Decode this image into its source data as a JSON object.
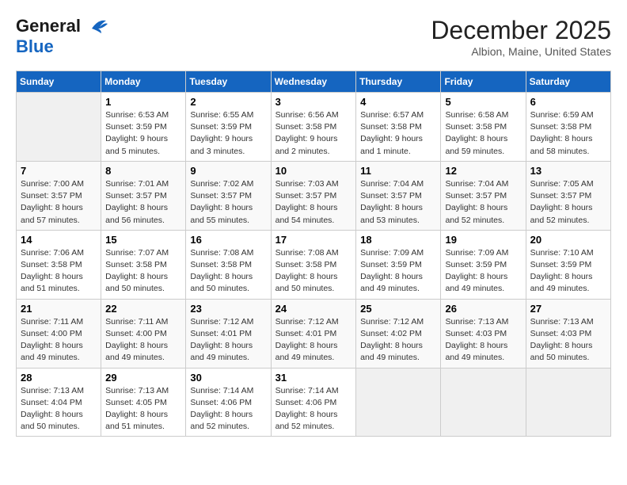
{
  "logo": {
    "general": "General",
    "blue": "Blue"
  },
  "title": "December 2025",
  "location": "Albion, Maine, United States",
  "days_of_week": [
    "Sunday",
    "Monday",
    "Tuesday",
    "Wednesday",
    "Thursday",
    "Friday",
    "Saturday"
  ],
  "weeks": [
    [
      {
        "day": "",
        "empty": true
      },
      {
        "day": "1",
        "sunrise": "Sunrise: 6:53 AM",
        "sunset": "Sunset: 3:59 PM",
        "daylight": "Daylight: 9 hours and 5 minutes."
      },
      {
        "day": "2",
        "sunrise": "Sunrise: 6:55 AM",
        "sunset": "Sunset: 3:59 PM",
        "daylight": "Daylight: 9 hours and 3 minutes."
      },
      {
        "day": "3",
        "sunrise": "Sunrise: 6:56 AM",
        "sunset": "Sunset: 3:58 PM",
        "daylight": "Daylight: 9 hours and 2 minutes."
      },
      {
        "day": "4",
        "sunrise": "Sunrise: 6:57 AM",
        "sunset": "Sunset: 3:58 PM",
        "daylight": "Daylight: 9 hours and 1 minute."
      },
      {
        "day": "5",
        "sunrise": "Sunrise: 6:58 AM",
        "sunset": "Sunset: 3:58 PM",
        "daylight": "Daylight: 8 hours and 59 minutes."
      },
      {
        "day": "6",
        "sunrise": "Sunrise: 6:59 AM",
        "sunset": "Sunset: 3:58 PM",
        "daylight": "Daylight: 8 hours and 58 minutes."
      }
    ],
    [
      {
        "day": "7",
        "sunrise": "Sunrise: 7:00 AM",
        "sunset": "Sunset: 3:57 PM",
        "daylight": "Daylight: 8 hours and 57 minutes."
      },
      {
        "day": "8",
        "sunrise": "Sunrise: 7:01 AM",
        "sunset": "Sunset: 3:57 PM",
        "daylight": "Daylight: 8 hours and 56 minutes."
      },
      {
        "day": "9",
        "sunrise": "Sunrise: 7:02 AM",
        "sunset": "Sunset: 3:57 PM",
        "daylight": "Daylight: 8 hours and 55 minutes."
      },
      {
        "day": "10",
        "sunrise": "Sunrise: 7:03 AM",
        "sunset": "Sunset: 3:57 PM",
        "daylight": "Daylight: 8 hours and 54 minutes."
      },
      {
        "day": "11",
        "sunrise": "Sunrise: 7:04 AM",
        "sunset": "Sunset: 3:57 PM",
        "daylight": "Daylight: 8 hours and 53 minutes."
      },
      {
        "day": "12",
        "sunrise": "Sunrise: 7:04 AM",
        "sunset": "Sunset: 3:57 PM",
        "daylight": "Daylight: 8 hours and 52 minutes."
      },
      {
        "day": "13",
        "sunrise": "Sunrise: 7:05 AM",
        "sunset": "Sunset: 3:57 PM",
        "daylight": "Daylight: 8 hours and 52 minutes."
      }
    ],
    [
      {
        "day": "14",
        "sunrise": "Sunrise: 7:06 AM",
        "sunset": "Sunset: 3:58 PM",
        "daylight": "Daylight: 8 hours and 51 minutes."
      },
      {
        "day": "15",
        "sunrise": "Sunrise: 7:07 AM",
        "sunset": "Sunset: 3:58 PM",
        "daylight": "Daylight: 8 hours and 50 minutes."
      },
      {
        "day": "16",
        "sunrise": "Sunrise: 7:08 AM",
        "sunset": "Sunset: 3:58 PM",
        "daylight": "Daylight: 8 hours and 50 minutes."
      },
      {
        "day": "17",
        "sunrise": "Sunrise: 7:08 AM",
        "sunset": "Sunset: 3:58 PM",
        "daylight": "Daylight: 8 hours and 50 minutes."
      },
      {
        "day": "18",
        "sunrise": "Sunrise: 7:09 AM",
        "sunset": "Sunset: 3:59 PM",
        "daylight": "Daylight: 8 hours and 49 minutes."
      },
      {
        "day": "19",
        "sunrise": "Sunrise: 7:09 AM",
        "sunset": "Sunset: 3:59 PM",
        "daylight": "Daylight: 8 hours and 49 minutes."
      },
      {
        "day": "20",
        "sunrise": "Sunrise: 7:10 AM",
        "sunset": "Sunset: 3:59 PM",
        "daylight": "Daylight: 8 hours and 49 minutes."
      }
    ],
    [
      {
        "day": "21",
        "sunrise": "Sunrise: 7:11 AM",
        "sunset": "Sunset: 4:00 PM",
        "daylight": "Daylight: 8 hours and 49 minutes."
      },
      {
        "day": "22",
        "sunrise": "Sunrise: 7:11 AM",
        "sunset": "Sunset: 4:00 PM",
        "daylight": "Daylight: 8 hours and 49 minutes."
      },
      {
        "day": "23",
        "sunrise": "Sunrise: 7:12 AM",
        "sunset": "Sunset: 4:01 PM",
        "daylight": "Daylight: 8 hours and 49 minutes."
      },
      {
        "day": "24",
        "sunrise": "Sunrise: 7:12 AM",
        "sunset": "Sunset: 4:01 PM",
        "daylight": "Daylight: 8 hours and 49 minutes."
      },
      {
        "day": "25",
        "sunrise": "Sunrise: 7:12 AM",
        "sunset": "Sunset: 4:02 PM",
        "daylight": "Daylight: 8 hours and 49 minutes."
      },
      {
        "day": "26",
        "sunrise": "Sunrise: 7:13 AM",
        "sunset": "Sunset: 4:03 PM",
        "daylight": "Daylight: 8 hours and 49 minutes."
      },
      {
        "day": "27",
        "sunrise": "Sunrise: 7:13 AM",
        "sunset": "Sunset: 4:03 PM",
        "daylight": "Daylight: 8 hours and 50 minutes."
      }
    ],
    [
      {
        "day": "28",
        "sunrise": "Sunrise: 7:13 AM",
        "sunset": "Sunset: 4:04 PM",
        "daylight": "Daylight: 8 hours and 50 minutes."
      },
      {
        "day": "29",
        "sunrise": "Sunrise: 7:13 AM",
        "sunset": "Sunset: 4:05 PM",
        "daylight": "Daylight: 8 hours and 51 minutes."
      },
      {
        "day": "30",
        "sunrise": "Sunrise: 7:14 AM",
        "sunset": "Sunset: 4:06 PM",
        "daylight": "Daylight: 8 hours and 52 minutes."
      },
      {
        "day": "31",
        "sunrise": "Sunrise: 7:14 AM",
        "sunset": "Sunset: 4:06 PM",
        "daylight": "Daylight: 8 hours and 52 minutes."
      },
      {
        "day": "",
        "empty": true
      },
      {
        "day": "",
        "empty": true
      },
      {
        "day": "",
        "empty": true
      }
    ]
  ]
}
